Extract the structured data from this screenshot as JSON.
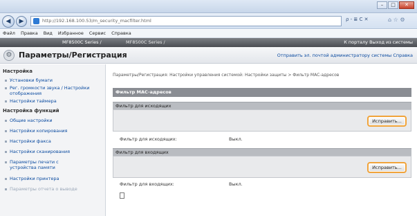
{
  "browser": {
    "url": "http://192.168.100.53/m_security_macfilter.html",
    "controls": {
      "minimize": "–",
      "maximize": "□",
      "close": "✕"
    },
    "back_glyph": "◀",
    "forward_glyph": "▶",
    "tools": "ρ - ≣ C ✕",
    "icons": "⌂ ☆ ⚙"
  },
  "menu": [
    "Файл",
    "Правка",
    "Вид",
    "Избранное",
    "Сервис",
    "Справка"
  ],
  "app": {
    "model": "MF8500C Series /",
    "model_path": "MF8500C Series /",
    "links": "К порталу   Выход из системы"
  },
  "header": {
    "title": "Параметры/Регистрация",
    "links": "Отправить эл. почтой администратору системы   Справка",
    "gear_glyph": "⚙"
  },
  "sidebar": {
    "section1": "Настройка",
    "items1": [
      "Установки бумаги",
      "Рег. громкости звука / Настройки отображения",
      "Настройки таймера"
    ],
    "section2": "Настройка функций",
    "items2": [
      "Общие настройки",
      "Настройки копирования",
      "Настройки факса",
      "Настройки сканирования",
      "Параметры печати с устройства памяти",
      "Настройки принтера",
      "Параметры отчета о выводе"
    ]
  },
  "main": {
    "breadcrumb": "Параметры/Регистрация: Настройки управления системой: Настройки защиты > Фильтр MAC-адресов",
    "section_title": "Фильтр MAC-адресов",
    "outgoing": {
      "title": "Фильтр для исходящих",
      "button": "Исправить...",
      "label": "Фильтр для исходящих:",
      "value": "Выкл."
    },
    "incoming": {
      "title": "Фильтр для входящих",
      "button": "Исправить...",
      "label": "Фильтр для входящих:",
      "value": "Выкл."
    }
  }
}
